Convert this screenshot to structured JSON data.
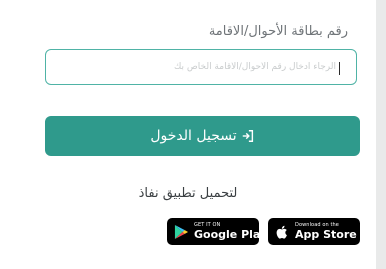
{
  "form": {
    "id_label": "رقم بطاقة الأحوال/الاقامة",
    "id_placeholder": "الرجاء ادخال رقم الأحوال/الاقامة الخاص بك",
    "login_label": "تسجيل الدخول",
    "login_icon": "sign-in-icon"
  },
  "download": {
    "label": "لتحميل تطبيق نفاذ",
    "google_play": {
      "small": "GET IT ON",
      "big": "Google Play",
      "icon": "google-play-icon"
    },
    "app_store": {
      "small": "Download on the",
      "big": "App Store",
      "icon": "apple-icon"
    }
  },
  "colors": {
    "accent": "#2f9a8c",
    "input_border": "#4fb3a6",
    "store_bg": "#000000",
    "page_bg": "#e9eaea"
  }
}
